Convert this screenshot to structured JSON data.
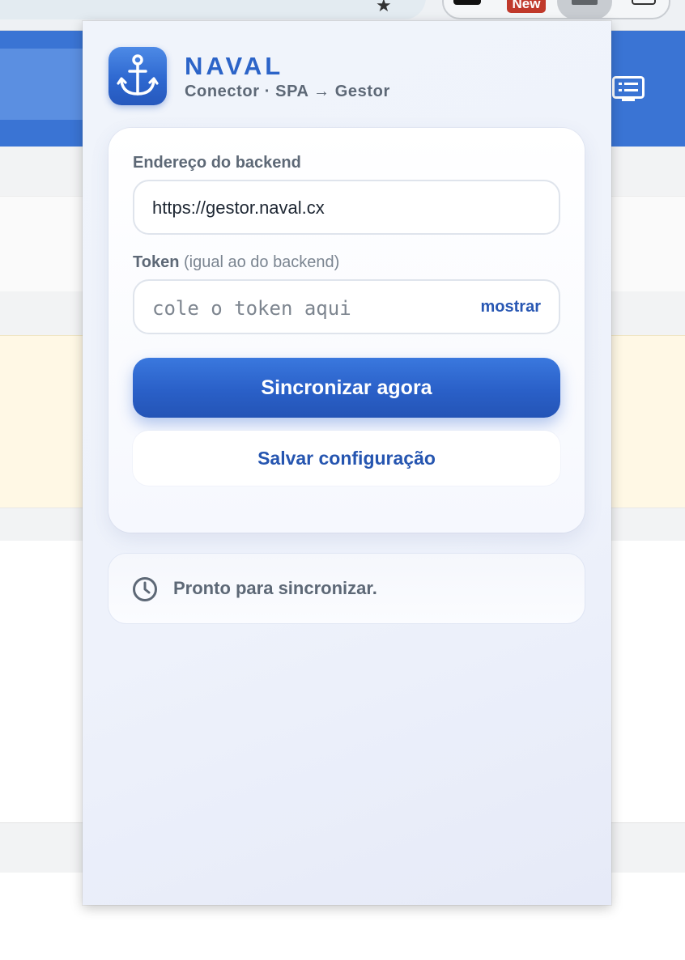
{
  "browser": {
    "badge_new": "New"
  },
  "popup": {
    "brand": {
      "title": "NAVAL",
      "subtitle": "Conector · SPA → Gestor",
      "logo_icon": "anchor-icon"
    },
    "form": {
      "backend_label": "Endereço do backend",
      "backend_value": "https://gestor.naval.cx",
      "token_label": "Token",
      "token_hint": "(igual ao do backend)",
      "token_placeholder": "cole o token aqui",
      "show_toggle": "mostrar",
      "sync_button": "Sincronizar agora",
      "save_button": "Salvar configuração"
    },
    "status": {
      "icon": "clock-icon",
      "text": "Pronto para sincronizar."
    }
  },
  "colors": {
    "accent": "#2c64c8",
    "primary_button": "#2a60c8",
    "page_header": "#3a74d4",
    "muted_text": "#5d6876",
    "new_badge": "#c0392b"
  }
}
